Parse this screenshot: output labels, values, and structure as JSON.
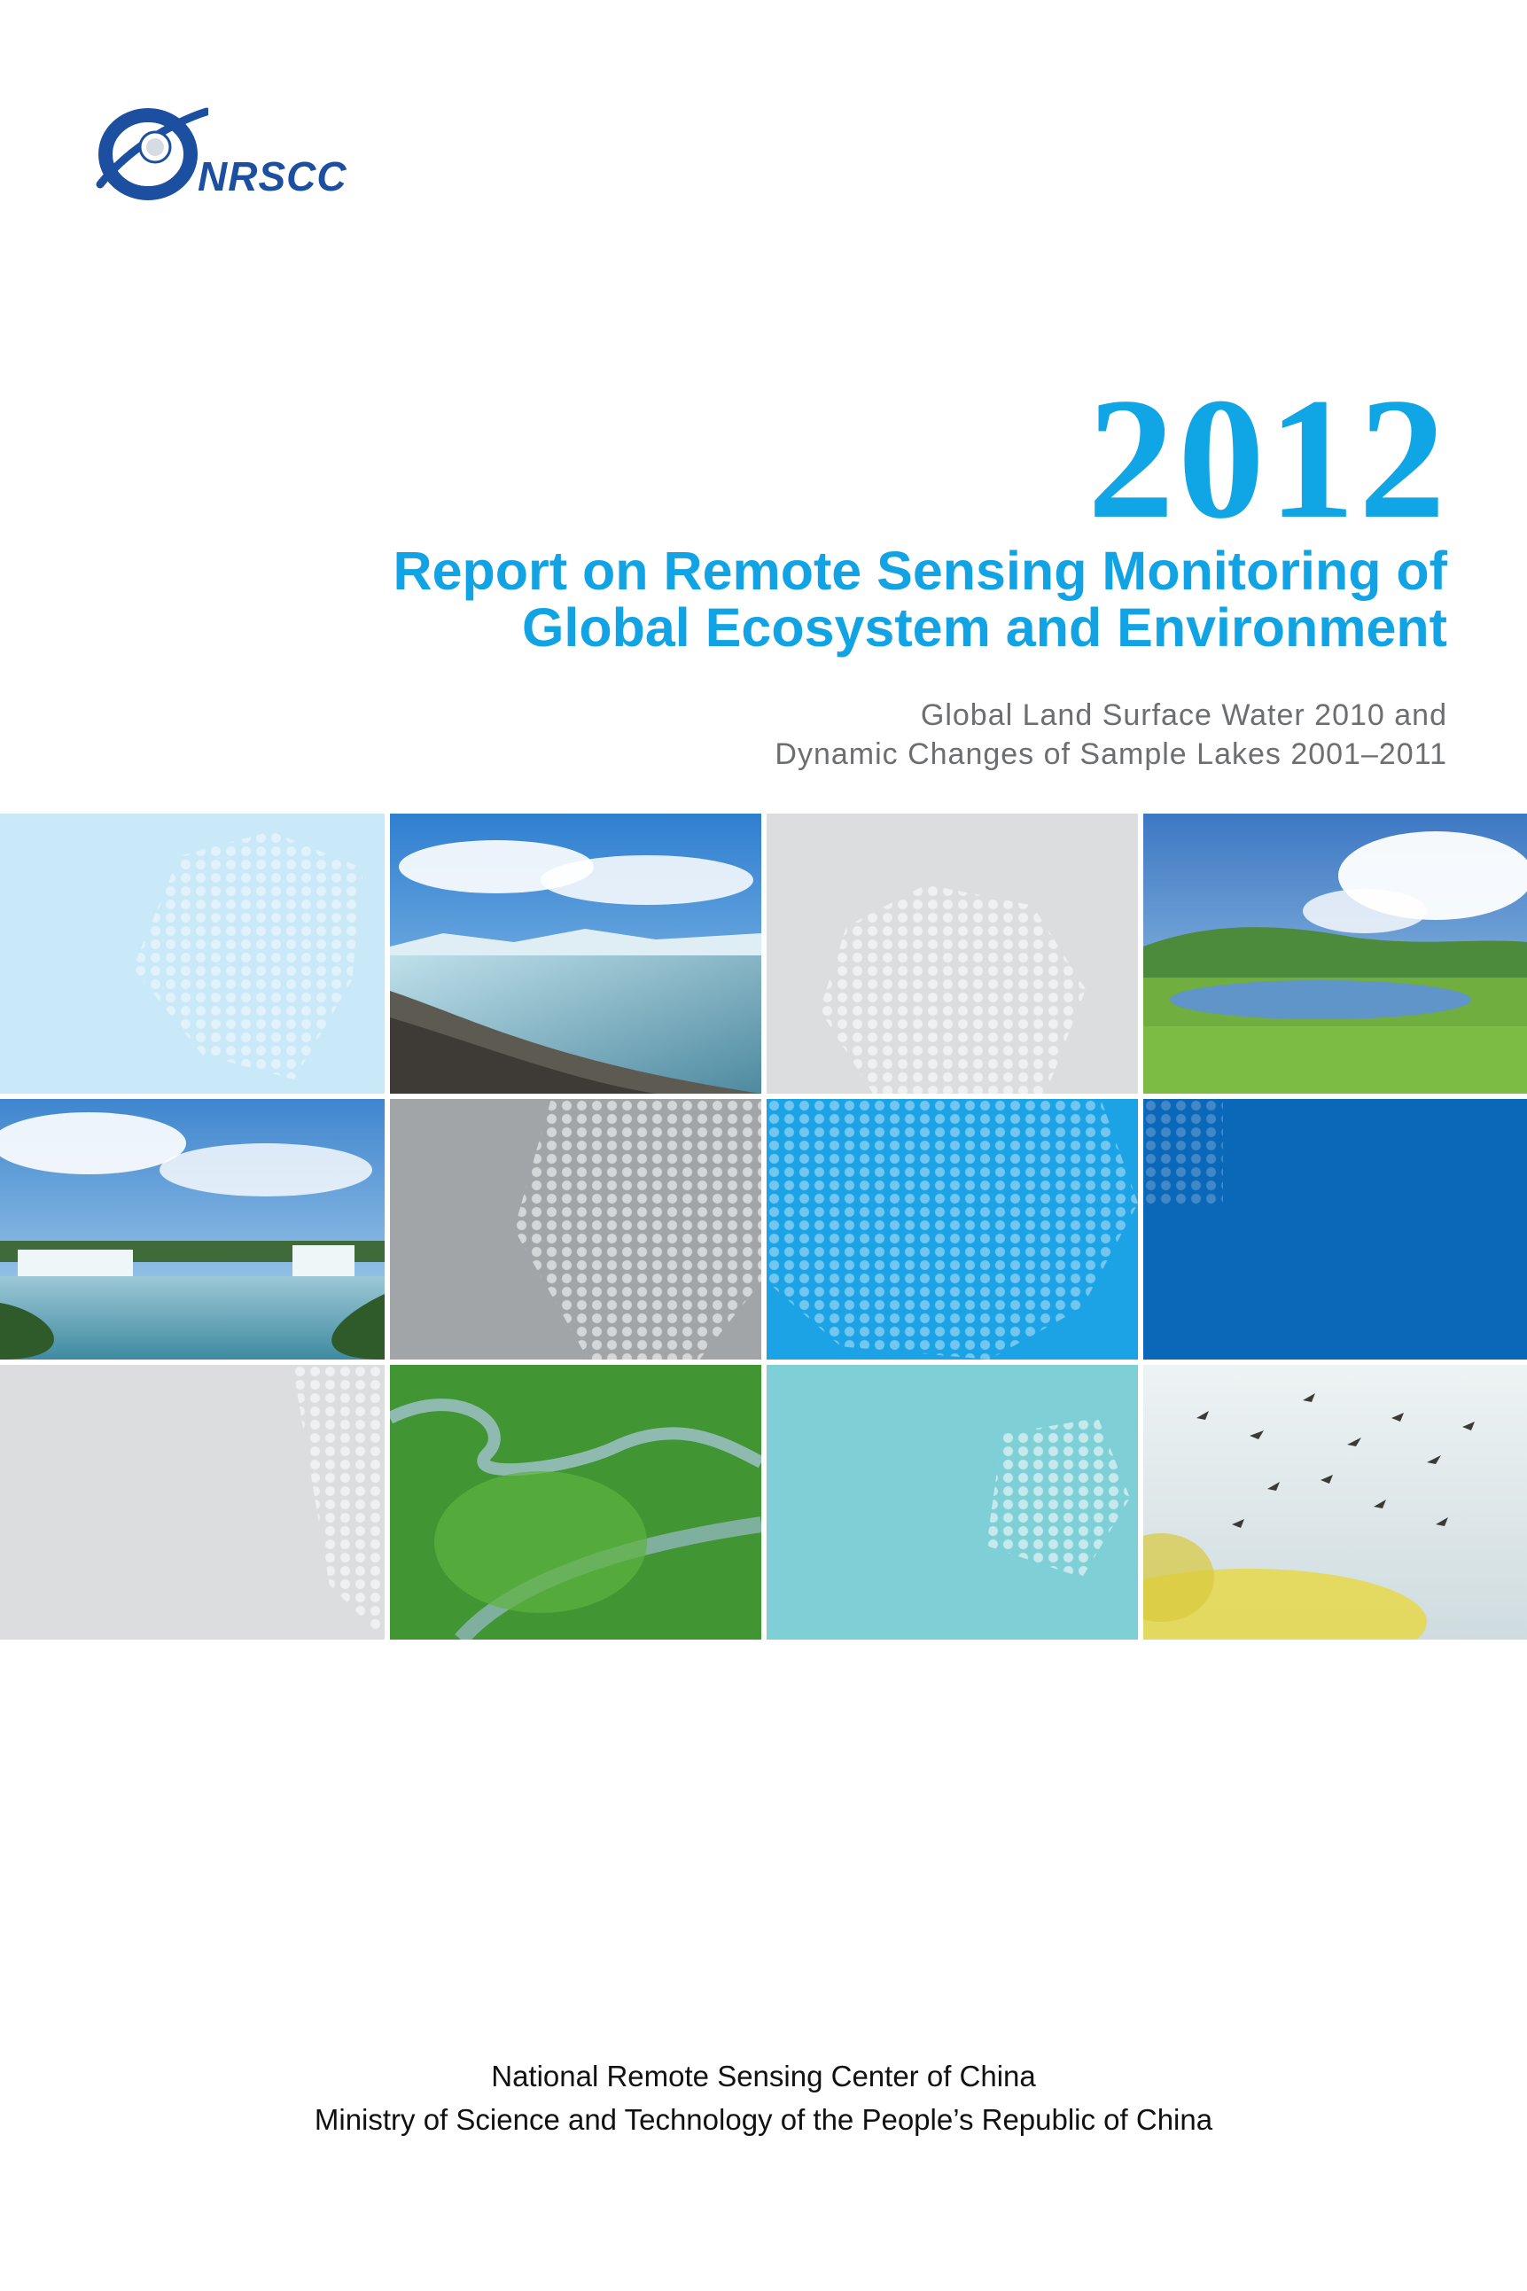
{
  "logo": {
    "text": "NRSCC",
    "icon": "nrscc-orbit-logo-icon",
    "color": "#1d4fa0"
  },
  "cover": {
    "year": "2012",
    "title_line1": "Report on Remote Sensing Monitoring of",
    "title_line2": "Global Ecosystem and Environment",
    "subtitle_line1": "Global Land Surface Water 2010 and",
    "subtitle_line2": "Dynamic Changes of Sample Lakes 2001–2011",
    "accent_color": "#11a3e3"
  },
  "mosaic": {
    "tiles": [
      {
        "kind": "map-dots",
        "color": "#c9e8f8"
      },
      {
        "kind": "photo",
        "subject": "glacial-lake-shore"
      },
      {
        "kind": "map-dots",
        "color": "#dcdddf"
      },
      {
        "kind": "photo",
        "subject": "grassland-lake"
      },
      {
        "kind": "photo",
        "subject": "waterfall"
      },
      {
        "kind": "map-dots",
        "color": "#a2a5a8"
      },
      {
        "kind": "map-dots",
        "color": "#1ca3e6"
      },
      {
        "kind": "solid",
        "color": "#0b67b8"
      },
      {
        "kind": "map-dots",
        "color": "#dcdddf"
      },
      {
        "kind": "photo",
        "subject": "river-through-forest"
      },
      {
        "kind": "map-dots",
        "color": "#7fcfd6"
      },
      {
        "kind": "photo",
        "subject": "cranes-over-wetland"
      }
    ]
  },
  "footer": {
    "line1": "National Remote Sensing Center of China",
    "line2": "Ministry of Science and Technology of the People’s Republic of China"
  }
}
